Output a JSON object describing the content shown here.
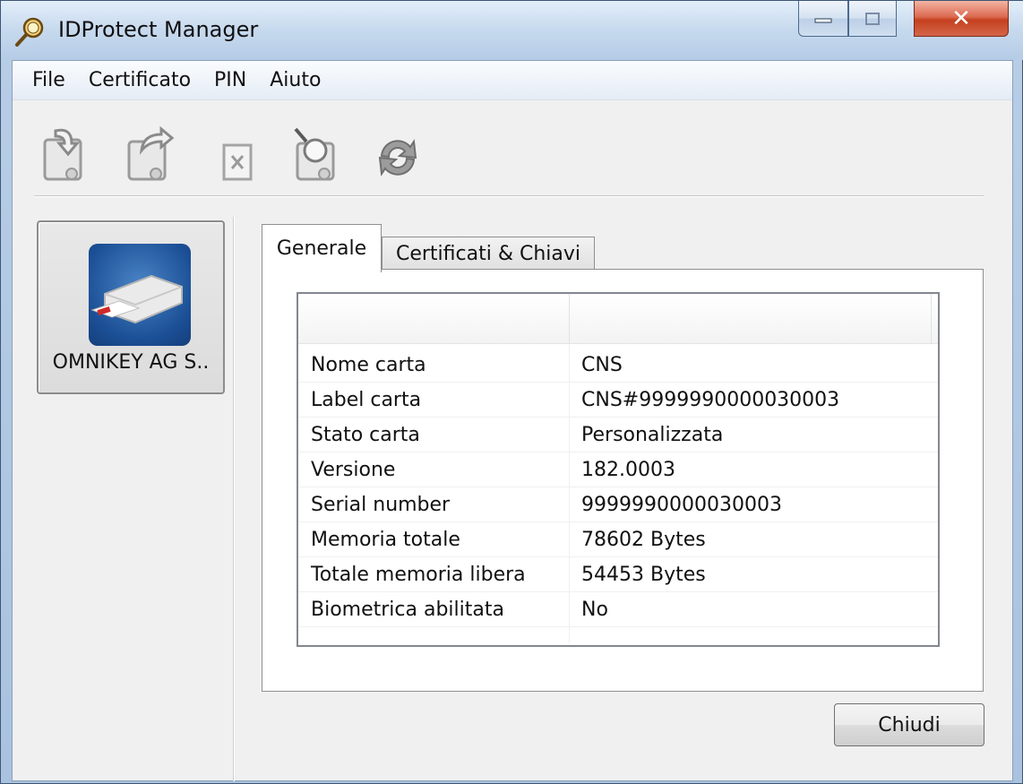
{
  "window": {
    "title": "IDProtect Manager"
  },
  "menu": {
    "items": [
      "File",
      "Certificato",
      "PIN",
      "Aiuto"
    ]
  },
  "toolbar": {
    "buttons": [
      "import-certificate-icon",
      "export-certificate-icon",
      "delete-icon",
      "view-certificate-icon",
      "refresh-icon"
    ]
  },
  "device": {
    "label": "OMNIKEY AG S.."
  },
  "tabs": {
    "general": "Generale",
    "certs": "Certificati & Chiavi"
  },
  "info": {
    "rows": [
      {
        "key": "Nome carta",
        "value": "CNS"
      },
      {
        "key": "Label carta",
        "value": "CNS#9999990000030003"
      },
      {
        "key": "Stato carta",
        "value": "Personalizzata"
      },
      {
        "key": "Versione",
        "value": "182.0003"
      },
      {
        "key": "Serial number",
        "value": "9999990000030003"
      },
      {
        "key": "Memoria totale",
        "value": "78602 Bytes"
      },
      {
        "key": "Totale memoria libera",
        "value": "54453 Bytes"
      },
      {
        "key": "Biometrica abilitata",
        "value": "No"
      }
    ]
  },
  "footer": {
    "close_label": "Chiudi"
  },
  "colors": {
    "title_bar": "#c6d9ee",
    "close_button": "#c4401f",
    "device_tile": "#1b4f95"
  }
}
